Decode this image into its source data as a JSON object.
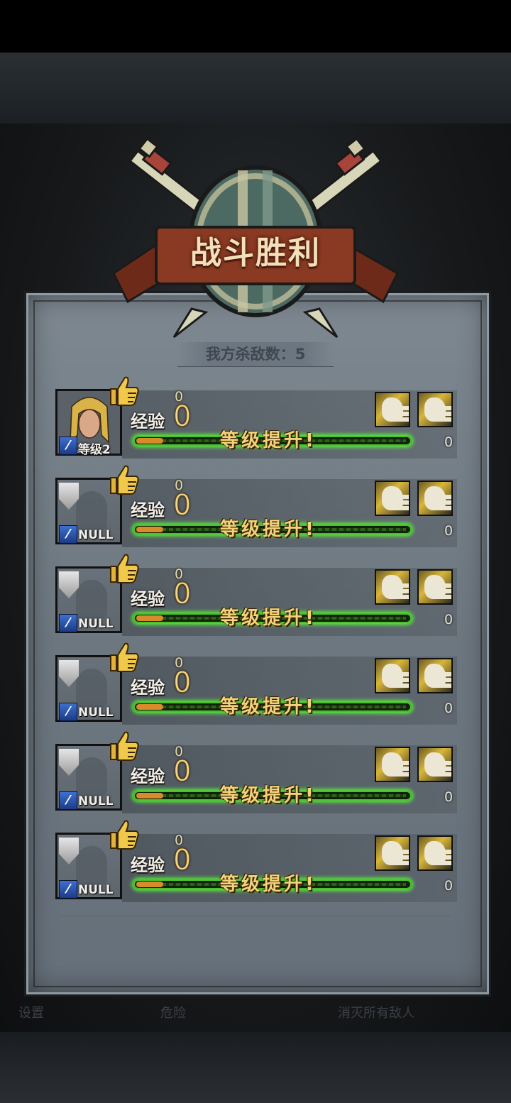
{
  "title": "战斗胜利",
  "kills": {
    "label": "我方杀敌数：",
    "value": "5"
  },
  "exp_label": "经验",
  "levelup_text": "等级提升!",
  "bottom_hint": {
    "left": "设置",
    "middle": "危险",
    "right": "消灭所有敌人"
  },
  "heroes": [
    {
      "type": "hero",
      "level": "等级2",
      "exp_gain": "0",
      "exp": "0",
      "exp_progress": 0.1,
      "remaining": "0"
    },
    {
      "type": "empty",
      "level": "NULL",
      "exp_gain": "0",
      "exp": "0",
      "exp_progress": 0.1,
      "remaining": "0"
    },
    {
      "type": "empty",
      "level": "NULL",
      "exp_gain": "0",
      "exp": "0",
      "exp_progress": 0.1,
      "remaining": "0"
    },
    {
      "type": "empty",
      "level": "NULL",
      "exp_gain": "0",
      "exp": "0",
      "exp_progress": 0.1,
      "remaining": "0"
    },
    {
      "type": "empty",
      "level": "NULL",
      "exp_gain": "0",
      "exp": "0",
      "exp_progress": 0.1,
      "remaining": "0"
    },
    {
      "type": "empty",
      "level": "NULL",
      "exp_gain": "0",
      "exp": "0",
      "exp_progress": 0.1,
      "remaining": "0"
    }
  ],
  "colors": {
    "panel": "#6d7780",
    "glow": "#55ff33",
    "gold": "#f3d27a",
    "banner": "#7a2f1c"
  }
}
